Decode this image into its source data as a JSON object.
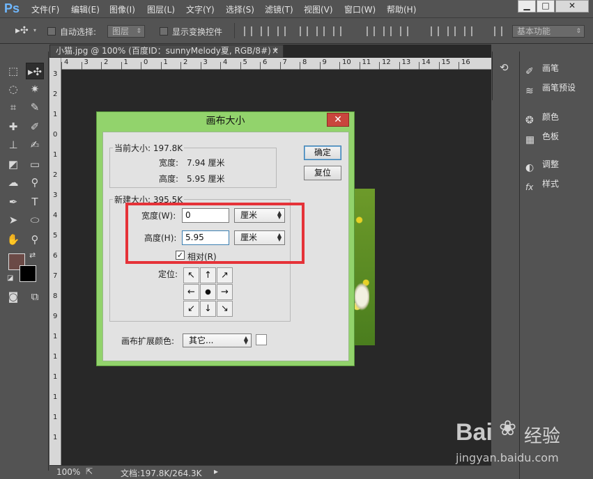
{
  "app": {
    "logo": "Ps"
  },
  "menu": [
    "文件(F)",
    "编辑(E)",
    "图像(I)",
    "图层(L)",
    "文字(Y)",
    "选择(S)",
    "滤镜(T)",
    "视图(V)",
    "窗口(W)",
    "帮助(H)"
  ],
  "window_controls": [
    "▁",
    "□",
    "✕"
  ],
  "options": {
    "auto_select_label": "自动选择:",
    "auto_select_target": "图层",
    "show_transform_label": "显示变换控件",
    "workspace": "基本功能"
  },
  "document": {
    "tab_title": "小猫.jpg @ 100% (百度ID：sunnyMelody夏, RGB/8#) *",
    "tab_close": "×",
    "zoom": "100%",
    "doc_info": "文档:197.8K/264.3K"
  },
  "ruler": {
    "top_ticks": [
      "4",
      "3",
      "2",
      "1",
      "0",
      "1",
      "2",
      "3",
      "4",
      "5",
      "6",
      "7",
      "8",
      "9",
      "10",
      "11",
      "12",
      "13",
      "14",
      "15",
      "16"
    ],
    "left_ticks": [
      "3",
      "2",
      "1",
      "0",
      "1",
      "2",
      "3",
      "4",
      "5",
      "6",
      "7",
      "8",
      "9",
      "1",
      "1",
      "1",
      "1",
      "1",
      "1"
    ]
  },
  "right_panels": {
    "items": [
      "画笔",
      "画笔预设",
      "颜色",
      "色板",
      "调整",
      "样式"
    ]
  },
  "dialog": {
    "title": "画布大小",
    "close": "✕",
    "ok_label": "确定",
    "reset_label": "复位",
    "current": {
      "title": "当前大小: 197.8K",
      "width_label": "宽度:",
      "width_value": "7.94 厘米",
      "height_label": "高度:",
      "height_value": "5.95 厘米"
    },
    "new": {
      "title": "新建大小: 395.5K",
      "width_label": "宽度(W):",
      "width_value": "0",
      "width_unit": "厘米",
      "height_label": "高度(H):",
      "height_value": "5.95",
      "height_unit": "厘米",
      "relative_label": "相对(R)",
      "relative_checked": true,
      "anchor_label": "定位:",
      "anchor_arrows": [
        "↖",
        "↑",
        "↗",
        "←",
        "●",
        "→",
        "↙",
        "↓",
        "↘"
      ]
    },
    "ext_color_label": "画布扩展颜色:",
    "ext_color_value": "其它...",
    "swatch_color": "#ffffff"
  },
  "watermark": {
    "brand": "Bai",
    "brand_cn": "经验",
    "url": "jingyan.baidu.com"
  },
  "colors": {
    "foreground": "#6b4a46",
    "background": "#000000",
    "highlight": "#e53238",
    "dialog_frame": "#92d36c"
  }
}
